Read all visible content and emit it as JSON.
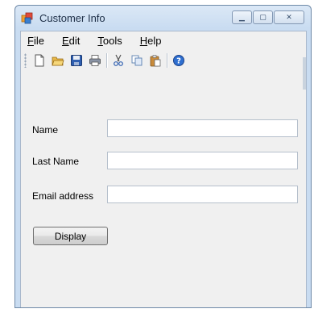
{
  "window": {
    "title": "Customer Info"
  },
  "window_buttons": {
    "minimize": "▁",
    "maximize": "▢",
    "close": "✕"
  },
  "menu": [
    {
      "accel": "F",
      "rest": "ile"
    },
    {
      "accel": "E",
      "rest": "dit"
    },
    {
      "accel": "T",
      "rest": "ools"
    },
    {
      "accel": "H",
      "rest": "elp"
    }
  ],
  "toolbar": {
    "icons": [
      "new-document-icon",
      "open-folder-icon",
      "save-icon",
      "print-icon",
      "cut-icon",
      "copy-icon",
      "paste-icon",
      "help-icon"
    ]
  },
  "form": {
    "name_label": "Name",
    "name_value": "",
    "last_name_label": "Last Name",
    "last_name_value": "",
    "email_label": "Email address",
    "email_value": "",
    "display_button": "Display"
  },
  "colors": {
    "accent": "#c9dcf1",
    "client_bg": "#f0f0f0"
  }
}
